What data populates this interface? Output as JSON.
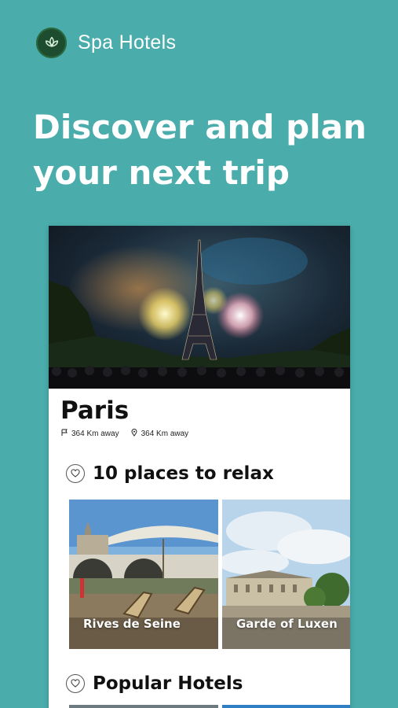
{
  "app": {
    "name": "Spa Hotels",
    "logo_icon": "leaf-icon"
  },
  "headline": {
    "line1": "Discover and plan",
    "line2": "your next trip"
  },
  "destination": {
    "city": "Paris",
    "distance_label": "364 Km away",
    "location_label": "364 Km away"
  },
  "sections": {
    "relax": {
      "title": "10 places to relax",
      "icon": "heart-icon"
    },
    "hotels": {
      "title": "Popular Hotels",
      "icon": "heart-icon"
    }
  },
  "places": [
    {
      "name": "Rives de Seine"
    },
    {
      "name": "Garde of Luxen"
    }
  ],
  "colors": {
    "background": "#4aacab",
    "card": "#ffffff",
    "logo": "#1d4d2e"
  }
}
